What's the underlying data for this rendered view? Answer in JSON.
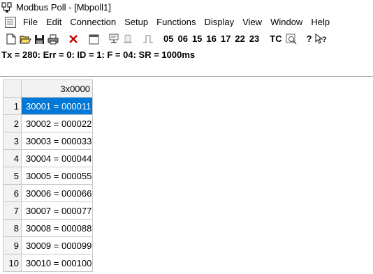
{
  "window": {
    "title": "Modbus Poll - [Mbpoll1]"
  },
  "menu": {
    "items": [
      "File",
      "Edit",
      "Connection",
      "Setup",
      "Functions",
      "Display",
      "View",
      "Window",
      "Help"
    ]
  },
  "toolbar": {
    "function_buttons": [
      "05",
      "06",
      "15",
      "16",
      "17",
      "22",
      "23"
    ],
    "tc_label": "TC",
    "help_symbol": "?"
  },
  "status": {
    "text": "Tx = 280: Err = 0: ID = 1: F = 04: SR = 1000ms"
  },
  "grid": {
    "column_header": "3x0000",
    "rows": [
      {
        "num": "1",
        "value": "30001 = 000011"
      },
      {
        "num": "2",
        "value": "30002 = 000022"
      },
      {
        "num": "3",
        "value": "30003 = 000033"
      },
      {
        "num": "4",
        "value": "30004 = 000044"
      },
      {
        "num": "5",
        "value": "30005 = 000055"
      },
      {
        "num": "6",
        "value": "30006 = 000066"
      },
      {
        "num": "7",
        "value": "30007 = 000077"
      },
      {
        "num": "8",
        "value": "30008 = 000088"
      },
      {
        "num": "9",
        "value": "30009 = 000099"
      },
      {
        "num": "10",
        "value": "30010 = 000100"
      }
    ],
    "selected_row": 1
  },
  "colors": {
    "selection": "#0078d7",
    "header_bg": "#f2f2f2"
  },
  "icons": {
    "toolbar": [
      "new-icon",
      "open-icon",
      "save-icon",
      "print-icon",
      "delete-icon",
      "window-icon",
      "connect-icon",
      "disconnect-icon",
      "pulse-icon",
      "test-center-icon",
      "help-icon",
      "context-help-icon"
    ]
  }
}
